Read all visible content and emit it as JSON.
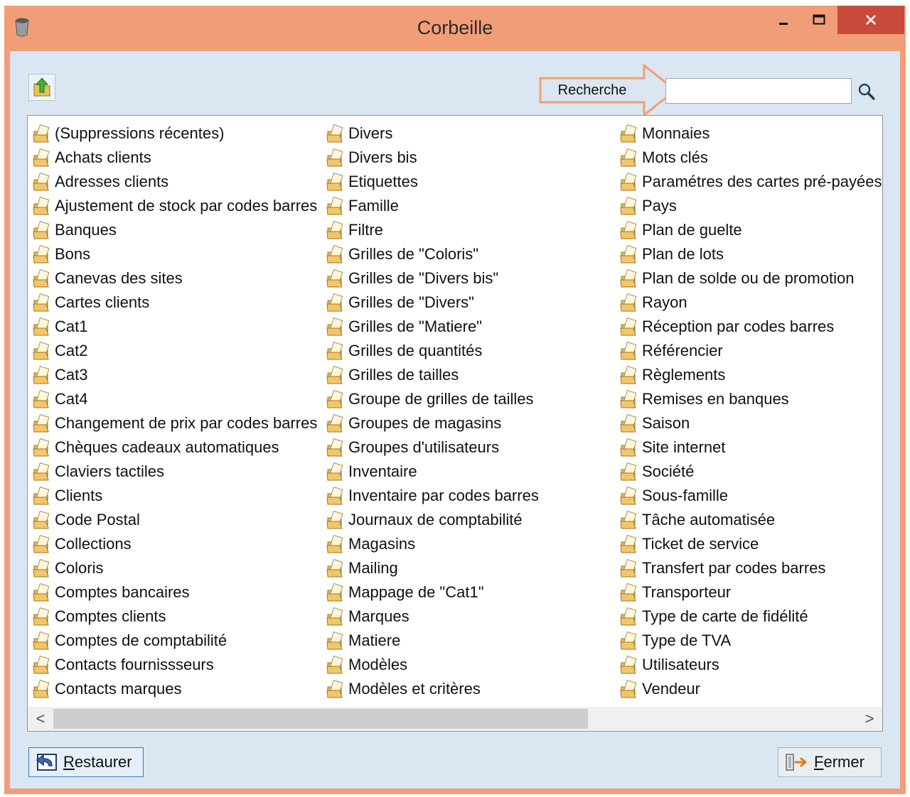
{
  "window": {
    "title": "Corbeille",
    "controls": {
      "minimize": "–",
      "maximize": "☐",
      "close": "✕"
    }
  },
  "toolbar": {
    "up_icon": "folder-up-arrow-icon",
    "search_label": "Recherche",
    "search_value": "",
    "search_placeholder": "",
    "search_icon": "magnifier-icon"
  },
  "list": {
    "item_icon": "folder-with-paper-icon",
    "columns": [
      [
        "(Suppressions récentes)",
        "Achats clients",
        "Adresses clients",
        "Ajustement de stock par codes barres",
        "Banques",
        "Bons",
        "Canevas des sites",
        "Cartes clients",
        "Cat1",
        "Cat2",
        "Cat3",
        "Cat4",
        "Changement de prix par codes barres",
        "Chèques cadeaux automatiques",
        "Claviers tactiles",
        "Clients",
        "Code Postal",
        "Collections",
        "Coloris",
        "Comptes bancaires",
        "Comptes clients",
        "Comptes de comptabilité",
        "Contacts fournissseurs",
        "Contacts marques"
      ],
      [
        "Divers",
        "Divers bis",
        "Etiquettes",
        "Famille",
        "Filtre",
        "Grilles de \"Coloris\"",
        "Grilles de \"Divers bis\"",
        "Grilles de \"Divers\"",
        "Grilles de \"Matiere\"",
        "Grilles de quantités",
        "Grilles de tailles",
        "Groupe de grilles de tailles",
        "Groupes de magasins",
        "Groupes d'utilisateurs",
        "Inventaire",
        "Inventaire par codes barres",
        "Journaux de comptabilité",
        "Magasins",
        "Mailing",
        "Mappage de \"Cat1\"",
        "Marques",
        "Matiere",
        "Modèles",
        "Modèles et critères"
      ],
      [
        "Monnaies",
        "Mots clés",
        "Paramétres des cartes pré-payées",
        "Pays",
        "Plan de guelte",
        "Plan de lots",
        "Plan de solde ou de promotion",
        "Rayon",
        "Réception par codes barres",
        "Référencier",
        "Règlements",
        "Remises en banques",
        "Saison",
        "Site internet",
        "Société",
        "Sous-famille",
        "Tâche automatisée",
        "Ticket de service",
        "Transfert par codes barres",
        "Transporteur",
        "Type de carte de fidélité",
        "Type de TVA",
        "Utilisateurs",
        "Vendeur"
      ]
    ]
  },
  "scrollbar": {
    "left_arrow": "<",
    "right_arrow": ">",
    "position": 0
  },
  "footer": {
    "restore_mnemonic": "R",
    "restore_rest": "estaurer",
    "restore_icon": "undo-arrow-icon",
    "close_mnemonic": "F",
    "close_rest": "ermer",
    "close_icon": "exit-door-icon"
  },
  "colors": {
    "titlebar": "#f19e78",
    "client": "#dae6f2",
    "close_button": "#c84b3c",
    "annotation_arrow": "#f0a070"
  }
}
